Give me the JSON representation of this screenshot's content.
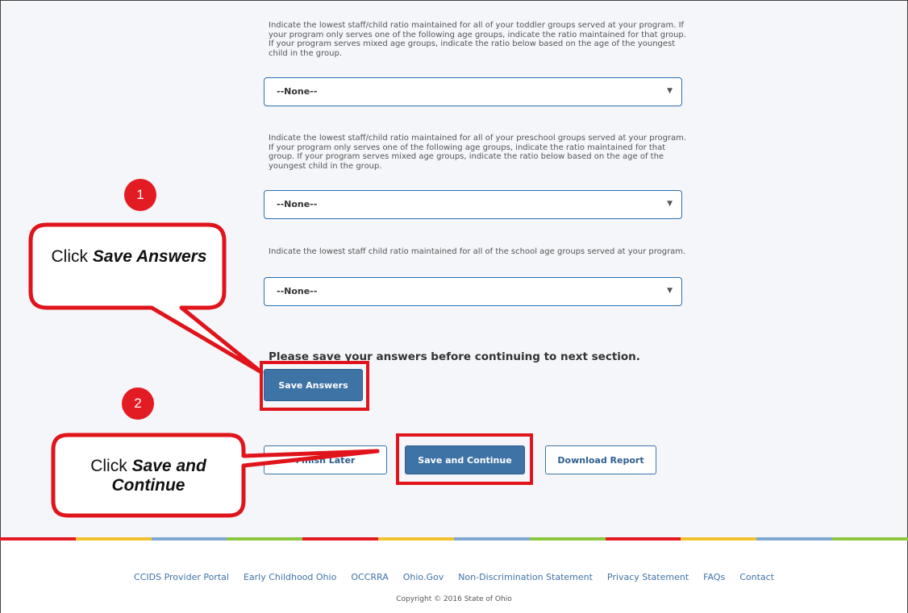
{
  "questions": [
    {
      "text": "Indicate the lowest staff/child ratio maintained for all of your toddler groups served at your program. If your program only serves one of the following age groups, indicate the ratio maintained for that group. If your program serves mixed age groups, indicate the ratio below based on the age of the youngest child in the group.",
      "selected": "--None--"
    },
    {
      "text": "Indicate the lowest staff/child ratio maintained for all of your preschool groups served at your program. If your program only serves one of the following age groups, indicate the ratio maintained for that group. If your program serves mixed age groups, indicate the ratio below based on the age of the youngest child in the group.",
      "selected": "--None--"
    },
    {
      "text": "Indicate the lowest staff child ratio maintained for all of the school age groups served at your program.",
      "selected": "--None--"
    }
  ],
  "save_note": "Please save your answers before continuing to next section.",
  "buttons": {
    "save_answers": "Save Answers",
    "finish_later": "Finish Later",
    "save_continue": "Save and Continue",
    "download_report": "Download Report"
  },
  "annotations": {
    "step1": "1",
    "step2": "2",
    "callout1_prefix": "Click ",
    "callout1_bold": "Save Answers",
    "callout2_prefix": "Click ",
    "callout2_bold": "Save and Continue"
  },
  "footer": {
    "links": [
      "CCIDS Provider Portal",
      "Early Childhood Ohio",
      "OCCRRA",
      "Ohio.Gov",
      "Non-Discrimination Statement",
      "Privacy Statement",
      "FAQs",
      "Contact"
    ],
    "copyright": "Copyright © 2016 State of Ohio"
  },
  "colors": {
    "accent": "#3e73a6",
    "highlight": "#e0141b",
    "stripe": [
      "#e31b23",
      "#f2c12e",
      "#7fa9d4",
      "#8dc63f"
    ]
  }
}
